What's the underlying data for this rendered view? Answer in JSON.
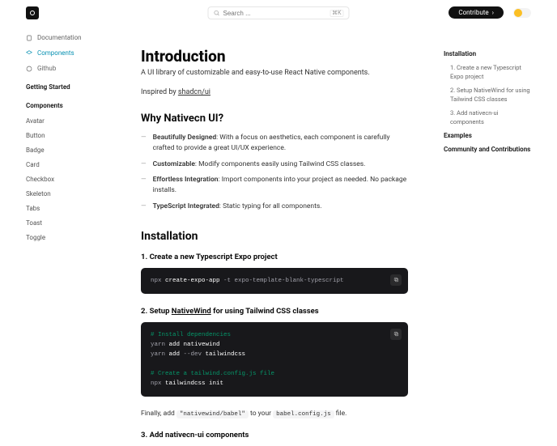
{
  "header": {
    "search_placeholder": "Search ...",
    "kbd": "⌘K",
    "contribute": "Contribute"
  },
  "sidebar": {
    "nav": [
      {
        "label": "Documentation",
        "icon": "file"
      },
      {
        "label": "Components",
        "icon": "layers",
        "active": true
      },
      {
        "label": "Github",
        "icon": "github"
      }
    ],
    "getting_started": "Getting Started",
    "components_h": "Components",
    "components": [
      "Avatar",
      "Button",
      "Badge",
      "Card",
      "Checkbox",
      "Skeleton",
      "Tabs",
      "Toast",
      "Toggle"
    ]
  },
  "main": {
    "title": "Introduction",
    "subtitle": "A UI library of customizable and easy-to-use React Native components.",
    "inspired_by": "Inspired by ",
    "inspired_link": "shadcn/ui",
    "why_h": "Why Nativecn UI?",
    "features": [
      {
        "b": "Beautifully Designed",
        "rest": ": With a focus on aesthetics, each component is carefully crafted to provide a great UI/UX experience."
      },
      {
        "b": "Customizable",
        "rest": ": Modify components easily using Tailwind CSS classes."
      },
      {
        "b": "Effortless Integration",
        "rest": ": Import components into your project as needed. No package installs."
      },
      {
        "b": "TypeScript Integrated",
        "rest": ": Static typing for all components."
      }
    ],
    "install_h": "Installation",
    "step1": "1. Create a new Typescript Expo project",
    "code1_pre": "npx ",
    "code1_cmd": "create-expo-app ",
    "code1_rest": "-t expo-template-blank-typescript",
    "step2_pre": "2. Setup ",
    "step2_link": "NativeWind",
    "step2_post": " for using Tailwind CSS classes",
    "code2_c1": "# Install dependencies",
    "code2_l1a": "yarn ",
    "code2_l1b": "add ",
    "code2_l1c": "nativewind",
    "code2_l2a": "yarn ",
    "code2_l2b": "add ",
    "code2_l2c": "--dev ",
    "code2_l2d": "tailwindcss",
    "code2_c2": "# Create a tailwind.config.js file",
    "code2_l3a": "npx ",
    "code2_l3b": "tailwindcss ",
    "code2_l3c": "init",
    "finally_pre": "Finally, add ",
    "finally_code1": "\"nativewind/babel\"",
    "finally_mid": " to your ",
    "finally_code2": "babel.config.js",
    "finally_post": " file.",
    "step3": "3. Add nativecn-ui components"
  },
  "toc": {
    "installation": "Installation",
    "items": [
      "1. Create a new Typescript Expo project",
      "2. Setup NativeWind for using Tailwind CSS classes",
      "3. Add nativecn-ui components"
    ],
    "examples": "Examples",
    "community": "Community and Contributions"
  }
}
